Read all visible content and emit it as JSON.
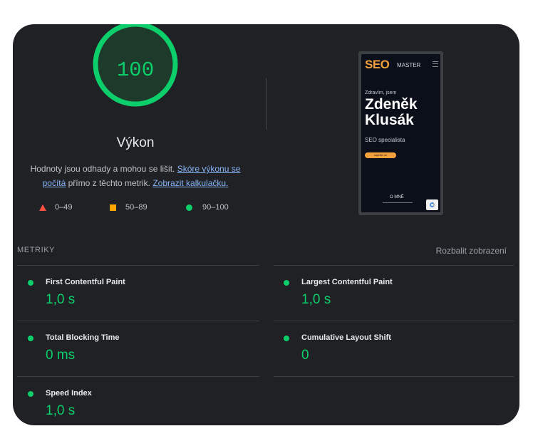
{
  "score": {
    "value": "100",
    "color": "#0cce6b",
    "title": "Výkon",
    "description_part1": "Hodnoty jsou odhady a mohou se lišit. ",
    "description_link1": "Skóre výkonu se počítá",
    "description_part2": " přímo z těchto metrik. ",
    "description_link2": "Zobrazit kalkulačku."
  },
  "legend": [
    {
      "icon": "triangle-red",
      "color": "#ff4e42",
      "label": "0–49"
    },
    {
      "icon": "square-orange",
      "color": "#ffa400",
      "label": "50–89"
    },
    {
      "icon": "circle-green",
      "color": "#0cce6b",
      "label": "90–100"
    }
  ],
  "screenshot": {
    "brand_seo": "SEO",
    "brand_master": "MASTER",
    "greeting": "Zdravím, jsem",
    "name_line1": "Zdeněk",
    "name_line2": "Klusák",
    "role": "SEO specialista",
    "button": "napište mi",
    "about": "O MNĚ"
  },
  "metrics": {
    "heading": "METRIKY",
    "expand": "Rozbalit zobrazení",
    "items": [
      {
        "label": "First Contentful Paint",
        "value": "1,0 s"
      },
      {
        "label": "Largest Contentful Paint",
        "value": "1,0 s"
      },
      {
        "label": "Total Blocking Time",
        "value": "0 ms"
      },
      {
        "label": "Cumulative Layout Shift",
        "value": "0"
      },
      {
        "label": "Speed Index",
        "value": "1,0 s"
      }
    ]
  }
}
